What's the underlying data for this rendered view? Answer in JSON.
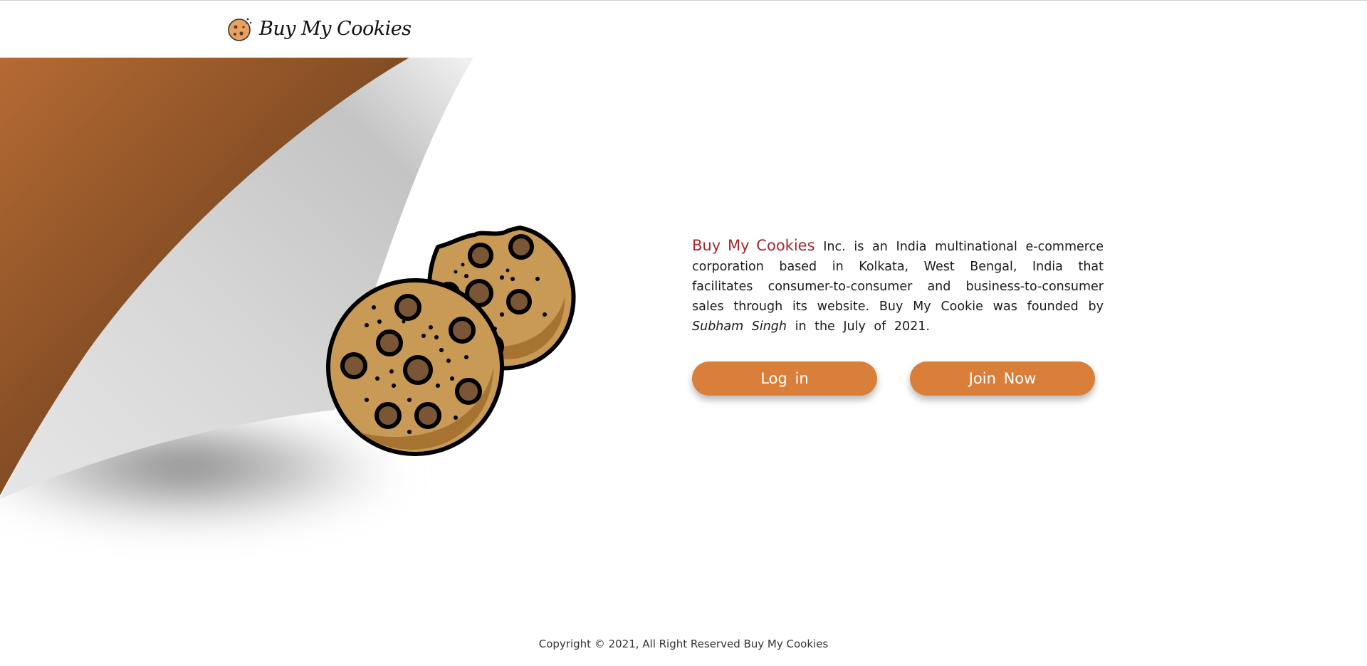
{
  "navbar": {
    "brand_name": "Buy My Cookies",
    "brand_icon": "cookie-icon"
  },
  "about": {
    "brand_name": "Buy My Cookies",
    "text_before_founder": "Inc. is an India multinational e-commerce corporation based in Kolkata, West Bengal, India that facilitates consumer-to-consumer and business-to-consumer sales through its website. Buy My Cookie was founded by",
    "founder": "Subham Singh",
    "text_after_founder": "in the July of 2021."
  },
  "buttons": {
    "login_label": "Log in",
    "join_label": "Join Now"
  },
  "footer": {
    "copyright": "Copyright © 2021, All Right Reserved Buy My Cookies"
  },
  "colors": {
    "accent": "#d97f3a",
    "brand_red": "#a3282d",
    "page_curl_brown": "#8a4e22",
    "cookie_dough": "#c99a55"
  }
}
